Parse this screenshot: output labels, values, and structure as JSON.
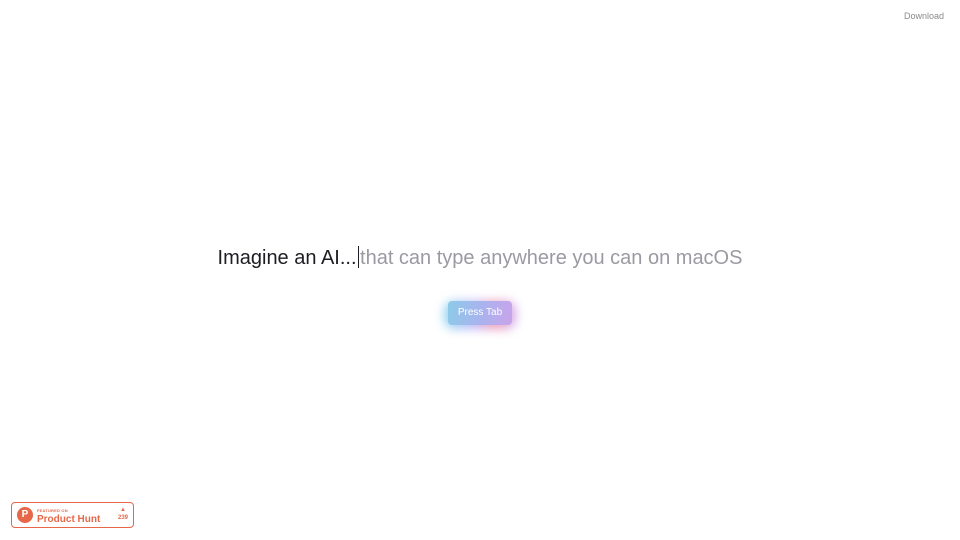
{
  "header": {
    "download_label": "Download"
  },
  "hero": {
    "typed_text": "Imagine an AI...",
    "suggestion_text": "that can type anywhere you can on macOS",
    "cta_label": "Press Tab"
  },
  "product_hunt": {
    "featured_label": "FEATURED ON",
    "name": "Product Hunt",
    "logo_letter": "P",
    "upvote_icon": "▲",
    "upvote_count": "239",
    "accent_color": "#e66849"
  },
  "colors": {
    "typed_text": "#1d1d22",
    "suggestion_text": "#9a9aa2",
    "download_link": "#8a8a8f"
  }
}
